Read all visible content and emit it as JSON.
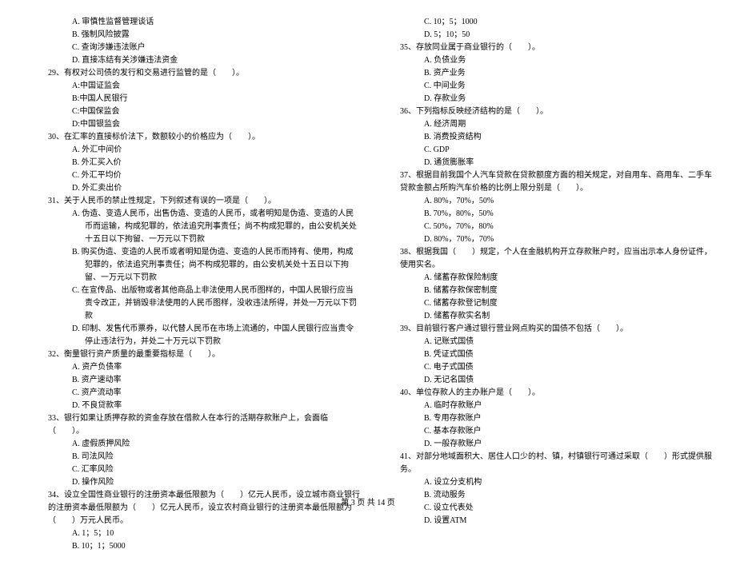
{
  "left_column": {
    "pre_options": [
      "A. 审慎性监督管理谈话",
      "B. 强制风险披露",
      "C. 查询涉嫌违法账户",
      "D. 直接冻结有关涉嫌违法资金"
    ],
    "q29": {
      "text": "29、有权对公司债的发行和交易进行监管的是（　　）。",
      "options": [
        "A:中国证监会",
        "B:中国人民银行",
        "C:中国保监会",
        "D:中国银监会"
      ]
    },
    "q30": {
      "text": "30、在汇率的直接标价法下，数额较小的价格应为（　　）。",
      "options": [
        "A. 外汇中间价",
        "B. 外汇买入价",
        "C. 外汇平均价",
        "D. 外汇卖出价"
      ]
    },
    "q31": {
      "text": "31、关于人民币的禁止性规定，下列叙述有误的一项是（　　）。",
      "options": [
        "A. 伪造、变造人民币，出售伪造、变造的人民币，或者明知是伪造、变造的人民币而运输，构成犯罪的，依法追究刑事责任；尚不构成犯罪的，由公安机关处十五日以下拘留、一万元以下罚款",
        "B. 购买伪造、变造的人民币或者明知是伪造、变造的人民币而持有、使用，构成犯罪的，依法追究刑事责任；尚不构成犯罪的，由公安机关处十五日以下拘留、一万元以下罚款",
        "C. 在宣传品、出版物或者其他商品上非法使用人民币图样的，中国人民银行应当责令改正，并销毁非法使用的人民币图样，没收违法所得，并处一万元以下罚款",
        "D. 印制、发售代币票券，以代替人民币在市场上流通的，中国人民银行应当责令停止违法行为，并处二十万元以下罚款"
      ]
    },
    "q32": {
      "text": "32、衡量银行资产质量的最重要指标是（　　）。",
      "options": [
        "A. 资产负债率",
        "B. 资产速动率",
        "C. 资产流动率",
        "D. 不良贷款率"
      ]
    },
    "q33": {
      "text": "33、银行如果让质押存款的资金存放在借款人在本行的活期存款账户上，会面临（　　）。",
      "options": [
        "A. 虚假质押风险",
        "B. 司法风险",
        "C. 汇率风险",
        "D. 操作风险"
      ]
    },
    "q34": {
      "text": "34、设立全国性商业银行的注册资本最低限额为（　　）亿元人民币，设立城市商业银行的注册资本最低限额为（　　）亿元人民币，设立农村商业银行的注册资本最低限额为（　　）万元人民币。",
      "options": [
        "A. 1；5；10",
        "B. 10；1；5000"
      ]
    }
  },
  "right_column": {
    "pre_options": [
      "C. 10；5；1000",
      "D. 5；10；50"
    ],
    "q35": {
      "text": "35、存放同业属于商业银行的（　　）。",
      "options": [
        "A. 负债业务",
        "B. 资产业务",
        "C. 中间业务",
        "D. 存款业务"
      ]
    },
    "q36": {
      "text": "36、下列指标反映经济结构的是（　　）。",
      "options": [
        "A. 经济周期",
        "B. 消费投资结构",
        "C. GDP",
        "D. 通货膨胀率"
      ]
    },
    "q37": {
      "text": "37、根据目前我国个人汽车贷款在贷款额度方面的相关规定，对自用车、商用车、二手车贷款金额占所购汽车价格的比例上限分别是（　　）。",
      "options": [
        "A. 80%，70%，50%",
        "B. 70%，80%，50%",
        "C. 50%，70%，80%",
        "D. 80%，70%，70%"
      ]
    },
    "q38": {
      "text": "38、根据我国（　　）规定，个人在金融机构开立存款账户时，应当出示本人身份证件，使用实名。",
      "options": [
        "A. 储蓄存款保险制度",
        "B. 储蓄存款保密制度",
        "C. 储蓄存款登记制度",
        "D. 储蓄存款实名制"
      ]
    },
    "q39": {
      "text": "39、目前银行客户通过银行营业网点购买的国债不包括（　　）。",
      "options": [
        "A. 记账式国债",
        "B. 凭证式国债",
        "C. 电子式国债",
        "D. 无记名国债"
      ]
    },
    "q40": {
      "text": "40、单位存款人的主办账户是（　　）。",
      "options": [
        "A. 临时存款账户",
        "B. 专用存款账户",
        "C. 基本存款账户",
        "D. 一般存款账户"
      ]
    },
    "q41": {
      "text": "41、对部分地域面积大、居住人口少的村、镇，村镇银行可通过采取（　　）形式提供服务。",
      "options": [
        "A. 设立分支机构",
        "B. 流动服务",
        "C. 设立代表处",
        "D. 设置ATM"
      ]
    }
  },
  "footer": "第 3 页 共 14 页"
}
